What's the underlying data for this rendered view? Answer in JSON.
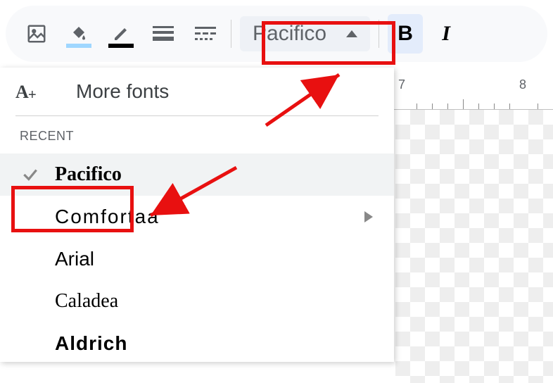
{
  "toolbar": {
    "font_selector_value": "Pacifico",
    "bold_label": "B",
    "italic_label": "I"
  },
  "dropdown": {
    "more_fonts_label": "More fonts",
    "section_recent": "RECENT",
    "fonts": {
      "pacifico": "Pacifico",
      "comfortaa": "Comfortaa",
      "arial": "Arial",
      "caladea": "Caladea",
      "aldrich": "Aldrich"
    }
  },
  "ruler": {
    "n7": "7",
    "n8": "8"
  },
  "annotation_color": "#e81010"
}
